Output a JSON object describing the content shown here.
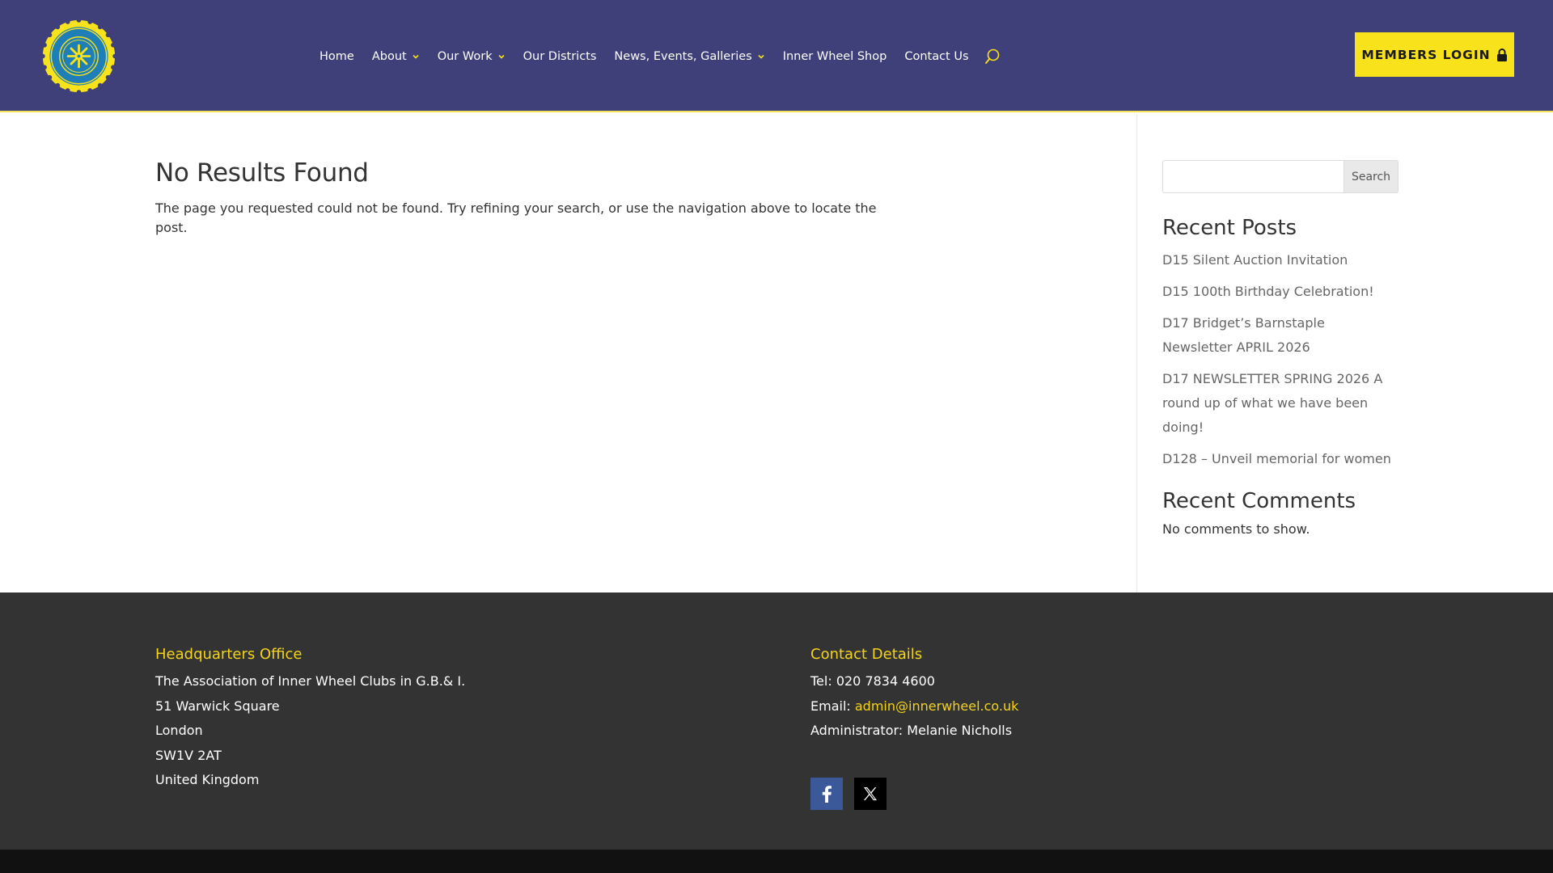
{
  "header": {
    "nav": [
      {
        "label": "Home",
        "has_dropdown": false
      },
      {
        "label": "About",
        "has_dropdown": true
      },
      {
        "label": "Our Work",
        "has_dropdown": true
      },
      {
        "label": "Our Districts",
        "has_dropdown": false
      },
      {
        "label": "News, Events, Galleries",
        "has_dropdown": true
      },
      {
        "label": "Inner Wheel Shop",
        "has_dropdown": false
      },
      {
        "label": "Contact Us",
        "has_dropdown": false
      }
    ],
    "search_icon": "search-icon",
    "login_label": "MEMBERS LOGIN",
    "login_icon": "lock-icon",
    "colors": {
      "bar": "#3f3f7a",
      "accent": "#f8e21c"
    }
  },
  "main": {
    "title": "No Results Found",
    "message": "The page you requested could not be found. Try refining your search, or use the navigation above to locate the post."
  },
  "sidebar": {
    "search_placeholder": "",
    "search_button": "Search",
    "recent_posts_title": "Recent Posts",
    "recent_posts": [
      "D15 Silent Auction Invitation",
      "D15 100th Birthday Celebration!",
      "D17 Bridget’s Barnstaple Newsletter APRIL 2026",
      "D17 NEWSLETTER SPRING 2026 A round up of what we have been doing!",
      "D128 – Unveil memorial for women"
    ],
    "recent_comments_title": "Recent Comments",
    "no_comments": "No comments to show."
  },
  "footer": {
    "hq": {
      "heading": "Headquarters Office",
      "lines": [
        "The Association of Inner Wheel Clubs in G.B.& I.",
        "51 Warwick Square",
        "London",
        "SW1V 2AT",
        "United Kingdom"
      ]
    },
    "contact": {
      "heading": "Contact Details",
      "tel": "Tel: 020 7834 4600",
      "email_label": "Email: ",
      "email": "admin@innerwheel.co.uk",
      "admin": "Administrator: Melanie Nicholls"
    },
    "socials": [
      {
        "icon": "facebook-icon",
        "color": "#3b5998"
      },
      {
        "icon": "x-twitter-icon",
        "color": "#000000"
      }
    ]
  }
}
